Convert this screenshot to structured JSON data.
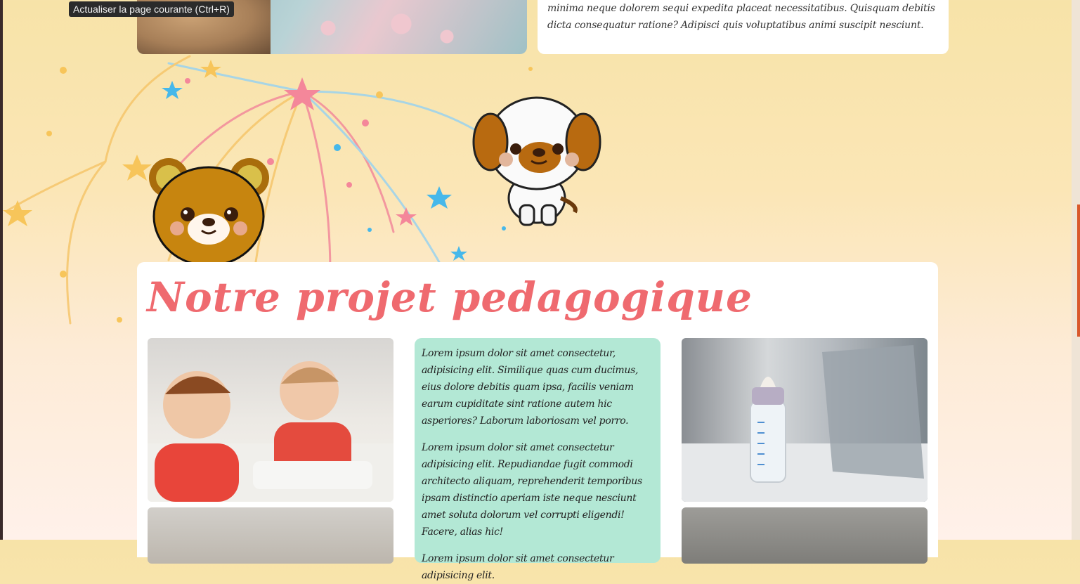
{
  "tooltip": {
    "text": "Actualiser la page courante (Ctrl+R)"
  },
  "top_card": {
    "text": "minima neque dolorem sequi expedita placeat necessitatibus. Quisquam debitis dicta consequatur ratione? Adipisci quis voluptatibus animi suscipit nesciunt."
  },
  "section": {
    "title": "Notre projet pedagogique",
    "paragraphs": [
      "Lorem ipsum dolor sit amet consectetur, adipisicing elit. Similique quas cum ducimus, eius dolore debitis quam ipsa, facilis veniam earum cupiditate sint ratione autem hic asperiores? Laborum laboriosam vel porro.",
      "Lorem ipsum dolor sit amet consectetur adipisicing elit. Repudiandae fugit commodi architecto aliquam, reprehenderit temporibus ipsam distinctio aperiam iste neque nesciunt amet soluta dolorum vel corrupti eligendi! Facere, alias hic!",
      "Lorem ipsum dolor sit amet consectetur adipisicing elit."
    ]
  },
  "colors": {
    "title": "#ef6a6f",
    "text_card": "#b3e8d5",
    "scroll_thumb": "#d9582c"
  },
  "icons": [
    "bear-mascot",
    "dog-mascot",
    "fireworks-decoration"
  ]
}
